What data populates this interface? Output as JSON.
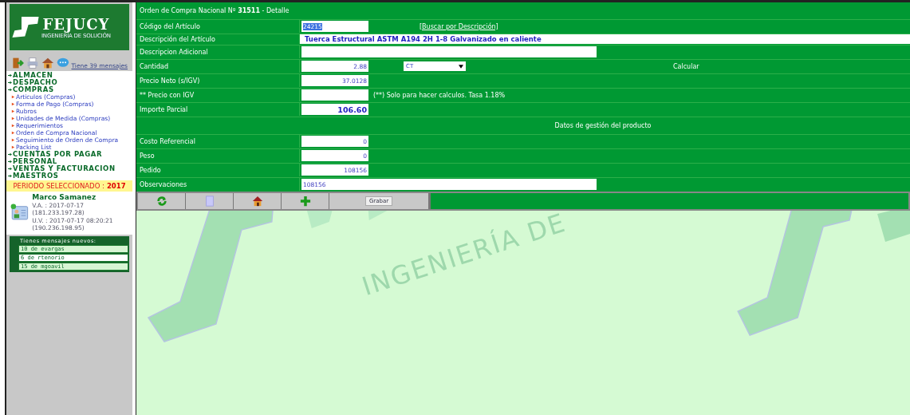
{
  "sidebar": {
    "logo": {
      "name": "FEJUCY",
      "tagline": "INGENIERÍA DE SOLUCIÓN"
    },
    "messages_link": "Tiene 39 mensajes",
    "menu": [
      {
        "label": "ALMACEN"
      },
      {
        "label": "DESPACHO"
      },
      {
        "label": "COMPRAS",
        "children": [
          {
            "label": "Articulos (Compras)"
          },
          {
            "label": "Forma de Pago (Compras)"
          },
          {
            "label": "Rubros"
          },
          {
            "label": "Unidades de Medida (Compras)"
          },
          {
            "label": "Requerimientos"
          },
          {
            "label": "Orden de Compra Nacional"
          },
          {
            "label": "Seguimiento de Orden de Compra"
          },
          {
            "label": "Packing List"
          }
        ]
      },
      {
        "label": "CUENTAS POR PAGAR"
      },
      {
        "label": "PERSONAL"
      },
      {
        "label": "VENTAS Y FACTURACION"
      },
      {
        "label": "MAESTROS"
      }
    ],
    "period": {
      "label": "PERIODO SELECCIONADO :",
      "year": "2017"
    },
    "user": {
      "name": "Marco Samanez",
      "last_access": "V.A. : 2017-07-17 (181.233.197.28)",
      "last_update": "U.V. : 2017-07-17 08:20:21",
      "ip": "(190.236.198.95)"
    },
    "new_messages": {
      "title": "Tienes mensajes nuevos:",
      "items": [
        {
          "text": "10 de evargas",
          "selected": false
        },
        {
          "text": "6 de rtenorio",
          "selected": true
        },
        {
          "text": "15 de mgoavil",
          "selected": false
        }
      ]
    }
  },
  "form": {
    "title": "Orden de Compra Nacional Nº **31511** - Detalle",
    "rows": [
      {
        "kind": "code",
        "label": "Código del Artículo",
        "value": "24215",
        "link": "[Buscar por Descripción]"
      },
      {
        "kind": "description",
        "label": "Descripción del Artículo",
        "value": "Tuerca Estructural ASTM A194 2H 1-8 Galvanizado en caliente"
      },
      {
        "kind": "wide",
        "label": "Descripcion Adicional",
        "value": ""
      },
      {
        "kind": "quantity",
        "label": "Cantidad",
        "value": "2.88",
        "unit": "CT",
        "action": "Calcular"
      },
      {
        "kind": "number",
        "label": "Precio Neto (s/IGV)",
        "value": "37.0128"
      },
      {
        "kind": "note",
        "label": "** Precio con IGV",
        "value": "",
        "note": "(**) Solo para hacer calculos. Tasa 1.18%"
      },
      {
        "kind": "total",
        "label": "Importe Parcial",
        "value": "106.60"
      },
      {
        "kind": "section",
        "label": "Datos de gestión del producto"
      },
      {
        "kind": "number",
        "label": "Costo Referencial",
        "value": "0"
      },
      {
        "kind": "number",
        "label": "Peso",
        "value": "0"
      },
      {
        "kind": "number",
        "label": "Pedido",
        "value": "108156"
      },
      {
        "kind": "wide",
        "label": "Observaciones",
        "value": "108156"
      }
    ],
    "toolbar": [
      {
        "kind": "refresh"
      },
      {
        "kind": "document"
      },
      {
        "kind": "home"
      },
      {
        "kind": "add"
      },
      {
        "kind": "button",
        "label": "Grabar"
      }
    ]
  },
  "background": {
    "text": "INGENIERÍA DE"
  }
}
